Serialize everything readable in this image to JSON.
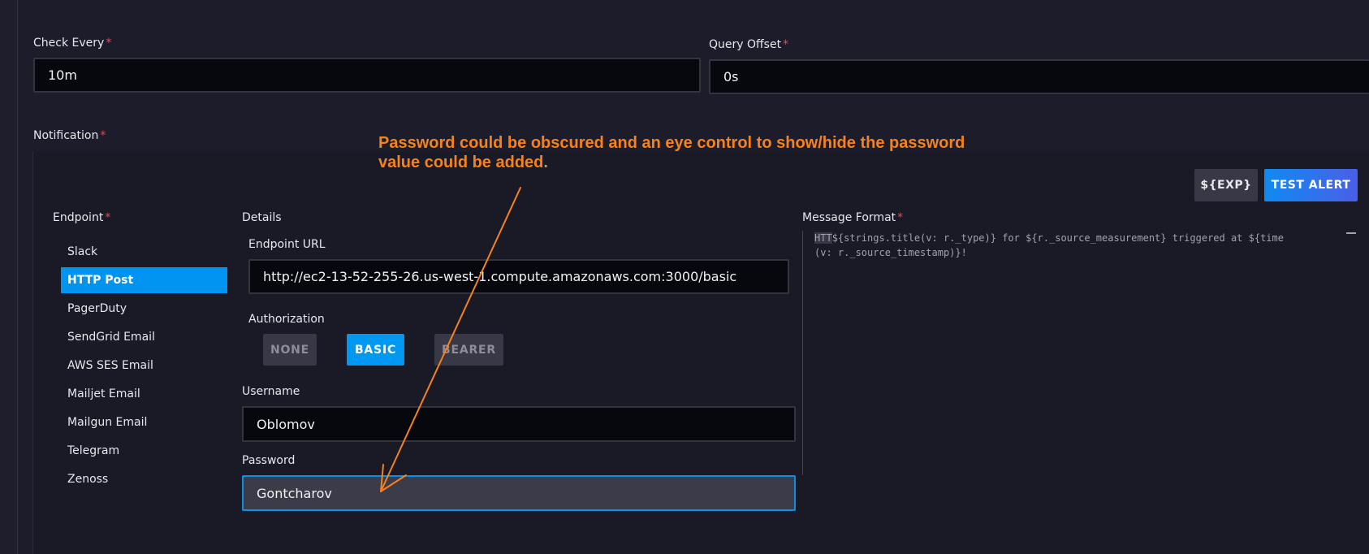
{
  "check_every": {
    "label": "Check Every",
    "value": "10m"
  },
  "query_offset": {
    "label": "Query Offset",
    "value": "0s"
  },
  "required_mark": "*",
  "notification": {
    "label": "Notification",
    "buttons": {
      "exp": "${EXP}",
      "test_alert": "TEST ALERT"
    },
    "endpoint_label": "Endpoint",
    "endpoints": [
      "Slack",
      "HTTP Post",
      "PagerDuty",
      "SendGrid Email",
      "AWS SES Email",
      "Mailjet Email",
      "Mailgun Email",
      "Telegram",
      "Zenoss"
    ],
    "selected_endpoint": "HTTP Post",
    "details": {
      "label": "Details",
      "endpoint_url_label": "Endpoint URL",
      "endpoint_url": "http://ec2-13-52-255-26.us-west-1.compute.amazonaws.com:3000/basic",
      "authorization_label": "Authorization",
      "auth_options": [
        "NONE",
        "BASIC",
        "BEARER"
      ],
      "auth_selected": "BASIC",
      "username_label": "Username",
      "username": "Oblomov",
      "password_label": "Password",
      "password": "Gontcharov"
    },
    "message_format": {
      "label": "Message Format",
      "highlighted": "HTT",
      "rest": "${strings.title(v: r._type)} for ${r._source_measurement} triggered at ${time\n(v: r._source_timestamp)}!"
    }
  },
  "annotation": {
    "text": "Password could be obscured and an eye control to show/hide the password value could be added.",
    "color": "#f7821b"
  },
  "colors": {
    "background": "#1c1c2b",
    "accent": "#0094f0",
    "required": "#dc4e58"
  }
}
